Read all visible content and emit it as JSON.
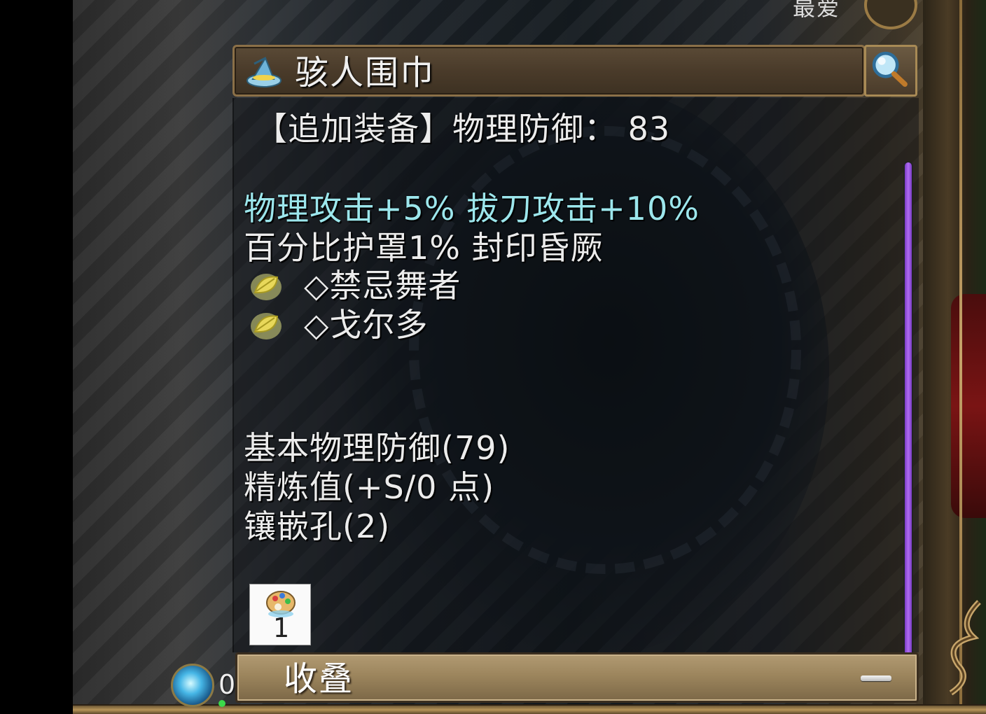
{
  "top_label": "最爱",
  "item": {
    "name": "骇人围巾",
    "slot_line": "【追加装备】物理防御： 83",
    "bonus_line_1": "物理攻击+5%  拔刀攻击+10%",
    "bonus_line_2": "百分比护罩1%  封印昏厥",
    "set_items": [
      "◇禁忌舞者",
      "◇戈尔多"
    ],
    "base_defense": "基本物理防御(79)",
    "refine": "精炼值(+S/0 点)",
    "sockets": "镶嵌孔(2)",
    "card_count": "1"
  },
  "collapse_label": "收叠",
  "orb_count": "0",
  "colors": {
    "bonus_text": "#9ce6ec",
    "body_text": "#ececec",
    "scrollbar": "#b06cf2",
    "title_bar": "#4a3b2a",
    "collapse_bar": "#9c855d"
  },
  "icons": {
    "title": "wizard-hat-icon",
    "search": "magnifier-icon",
    "set_gem": "yellow-leaf-gem-icon",
    "card": "palette-card-icon",
    "collapse": "minus-icon",
    "orb": "blue-orb-icon"
  }
}
